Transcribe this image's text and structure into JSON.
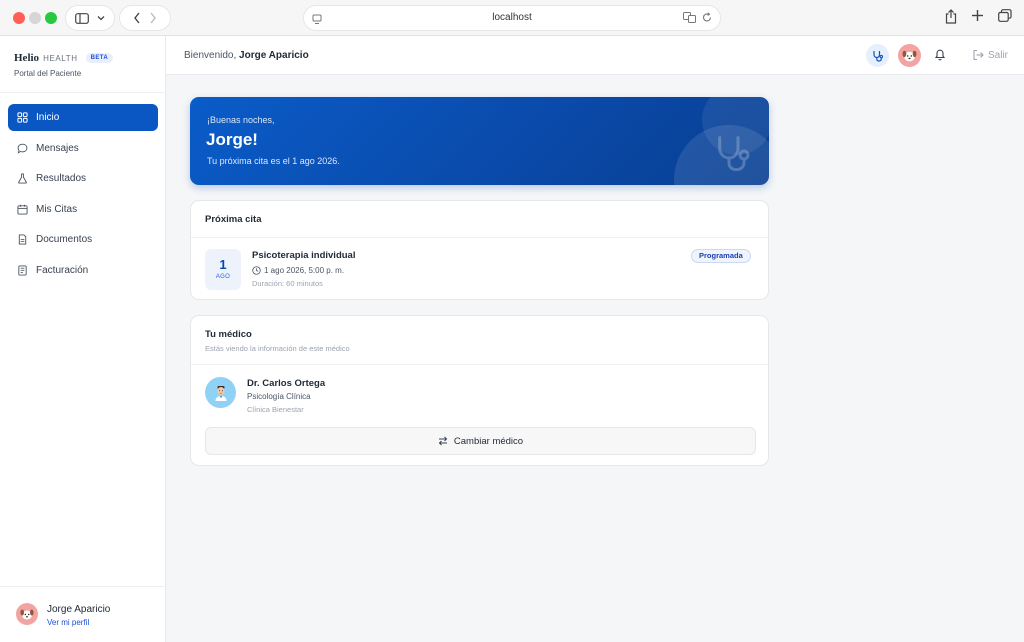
{
  "browser": {
    "url": "localhost"
  },
  "brand": {
    "name": "Helio",
    "sub_brand": "HEALTH",
    "badge": "BETA",
    "subtitle": "Portal del Paciente"
  },
  "sidebar": {
    "items": [
      {
        "label": "Inicio",
        "icon": "grid-icon",
        "active": true
      },
      {
        "label": "Mensajes",
        "icon": "chat-bubble-icon",
        "active": false
      },
      {
        "label": "Resultados",
        "icon": "flask-icon",
        "active": false
      },
      {
        "label": "Mis Citas",
        "icon": "calendar-icon",
        "active": false
      },
      {
        "label": "Documentos",
        "icon": "document-icon",
        "active": false
      },
      {
        "label": "Facturación",
        "icon": "receipt-icon",
        "active": false
      }
    ],
    "user": {
      "name": "Jorge Aparicio",
      "profile_link": "Ver mi perfil"
    }
  },
  "header": {
    "welcome_prefix": "Bienvenido,",
    "user_name": "Jorge Aparicio",
    "logout_label": "Salir"
  },
  "hero": {
    "greeting": "¡Buenas noches,",
    "name": "Jorge!",
    "message": "Tu próxima cita es el 1 ago 2026."
  },
  "next_appointment": {
    "title": "Próxima cita",
    "day": "1",
    "month": "AGO",
    "name": "Psicoterapia individual",
    "when": "1 ago 2026, 5:00 p. m.",
    "duration": "Duración: 60 minutos",
    "status": "Programada"
  },
  "doctor": {
    "title": "Tu médico",
    "subtitle": "Estás viendo la información de este médico",
    "name": "Dr. Carlos Ortega",
    "specialty": "Psicología Clínica",
    "clinic": "Clínica Bienestar",
    "change_label": "Cambiar médico"
  },
  "colors": {
    "primary": "#0a56c2",
    "avatar_user": "#f4a3a3",
    "avatar_doctor": "#8fd2f5"
  }
}
